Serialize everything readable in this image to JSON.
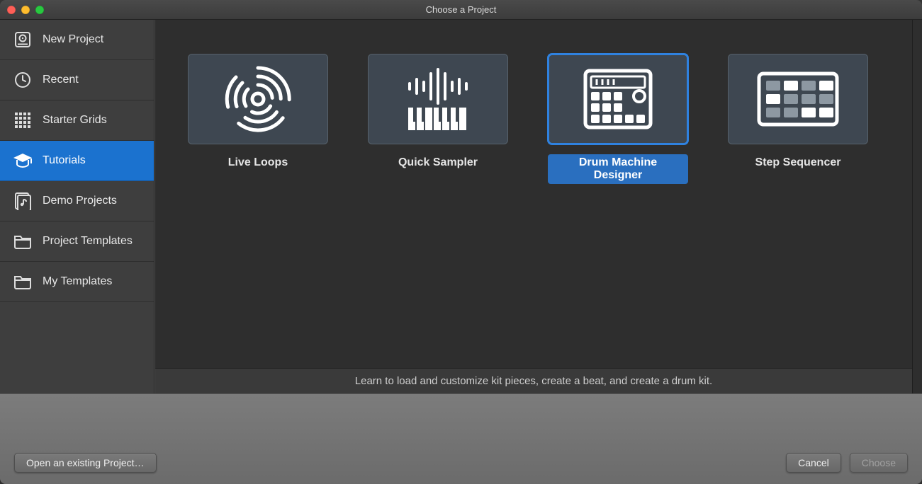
{
  "window": {
    "title": "Choose a Project"
  },
  "sidebar": {
    "items": [
      {
        "id": "new-project",
        "label": "New Project"
      },
      {
        "id": "recent",
        "label": "Recent"
      },
      {
        "id": "starter-grids",
        "label": "Starter Grids"
      },
      {
        "id": "tutorials",
        "label": "Tutorials",
        "selected": true
      },
      {
        "id": "demo-projects",
        "label": "Demo Projects"
      },
      {
        "id": "project-templates",
        "label": "Project Templates"
      },
      {
        "id": "my-templates",
        "label": "My Templates"
      }
    ]
  },
  "tiles": [
    {
      "id": "live-loops",
      "label": "Live Loops"
    },
    {
      "id": "quick-sampler",
      "label": "Quick Sampler"
    },
    {
      "id": "drum-machine-designer",
      "label": "Drum Machine Designer",
      "selected": true
    },
    {
      "id": "step-sequencer",
      "label": "Step Sequencer"
    }
  ],
  "description": "Learn to load and customize kit pieces, create a beat, and create a drum kit.",
  "footer": {
    "open_existing": "Open an existing Project…",
    "cancel": "Cancel",
    "choose": "Choose"
  }
}
